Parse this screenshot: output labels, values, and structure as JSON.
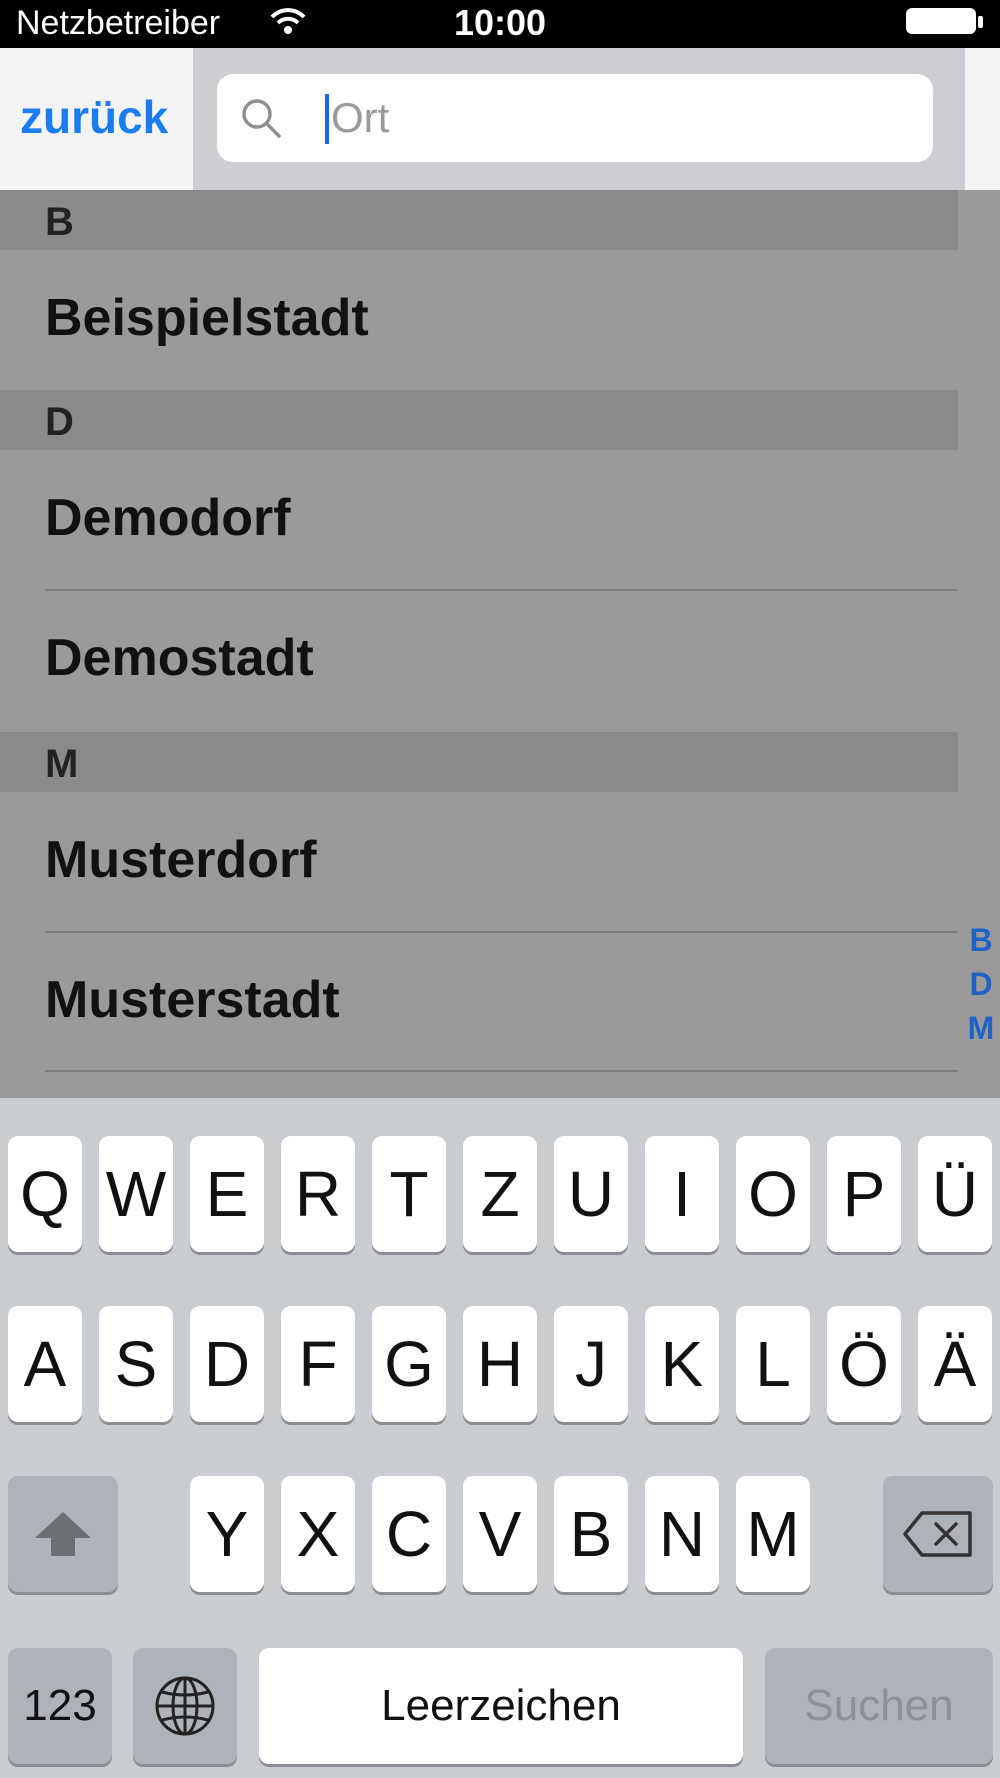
{
  "status_bar": {
    "carrier": "Netzbetreiber",
    "time": "10:00"
  },
  "nav": {
    "back_label": "zurück",
    "search_placeholder": "Ort"
  },
  "sections": [
    {
      "header": "B",
      "items": [
        "Beispielstadt"
      ]
    },
    {
      "header": "D",
      "items": [
        "Demodorf",
        "Demostadt"
      ]
    },
    {
      "header": "M",
      "items": [
        "Musterdorf",
        "Musterstadt"
      ]
    }
  ],
  "index": [
    "B",
    "D",
    "M"
  ],
  "keyboard": {
    "row1": [
      "Q",
      "W",
      "E",
      "R",
      "T",
      "Z",
      "U",
      "I",
      "O",
      "P",
      "Ü"
    ],
    "row2": [
      "A",
      "S",
      "D",
      "F",
      "G",
      "H",
      "J",
      "K",
      "L",
      "Ö",
      "Ä"
    ],
    "row3": [
      "Y",
      "X",
      "C",
      "V",
      "B",
      "N",
      "M"
    ],
    "numbers_label": "123",
    "space_label": "Leerzeichen",
    "search_label": "Suchen"
  },
  "colors": {
    "accent": "#1a7cf2",
    "index": "#1f62c8"
  },
  "icons": {
    "wifi": "wifi-icon",
    "battery": "battery-icon",
    "search": "search-icon",
    "shift": "shift-icon",
    "delete": "delete-icon",
    "globe": "globe-icon"
  }
}
